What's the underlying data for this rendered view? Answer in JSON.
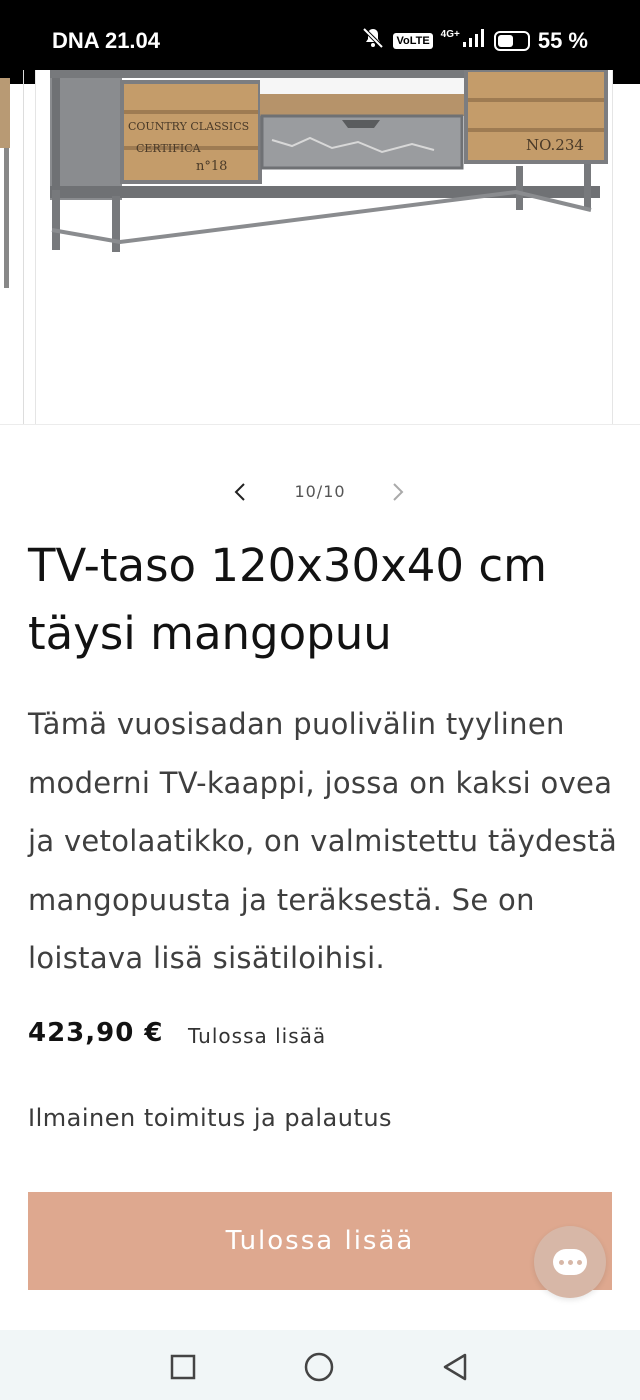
{
  "status_bar": {
    "carrier_time": "DNA 21.04",
    "volte": "VoLTE",
    "network": "4G+",
    "battery_level": 0.55,
    "battery_text": "55 %"
  },
  "gallery": {
    "current_page": 10,
    "total_pages": 10,
    "counter_text": "10/10",
    "image": {
      "crate_left_text_1": "COUNTRY CLASSICS",
      "crate_left_text_2": "CERTIFICA",
      "crate_left_text_3": "n°18",
      "crate_right_text": "NO.234"
    }
  },
  "product": {
    "title": "TV-taso 120x30x40 cm täysi mangopuu",
    "description": "Tämä vuosisadan puolivälin tyylinen moderni TV-kaappi, jossa on kaksi ovea ja vetolaatikko, on valmistettu täydestä mangopuusta ja teräksestä. Se on loistava lisä sisätiloihisi.",
    "price": "423,90 €",
    "availability": "Tulossa lisää",
    "shipping": "Ilmainen toimitus ja palautus",
    "cta_label": "Tulossa lisää"
  },
  "colors": {
    "cta_background": "#dea88f",
    "chat_background": "#d7b7a7",
    "status_bar": "#000000",
    "nav_bar": "#f1f6f7"
  },
  "icons": {
    "status": [
      "silent-bell-icon",
      "volte-icon",
      "signal-icon",
      "battery-icon"
    ],
    "pager": [
      "chevron-left-icon",
      "chevron-right-icon"
    ],
    "chat": "chat-bubble-icon",
    "nav": [
      "recents-square-icon",
      "home-circle-icon",
      "back-triangle-icon"
    ]
  }
}
